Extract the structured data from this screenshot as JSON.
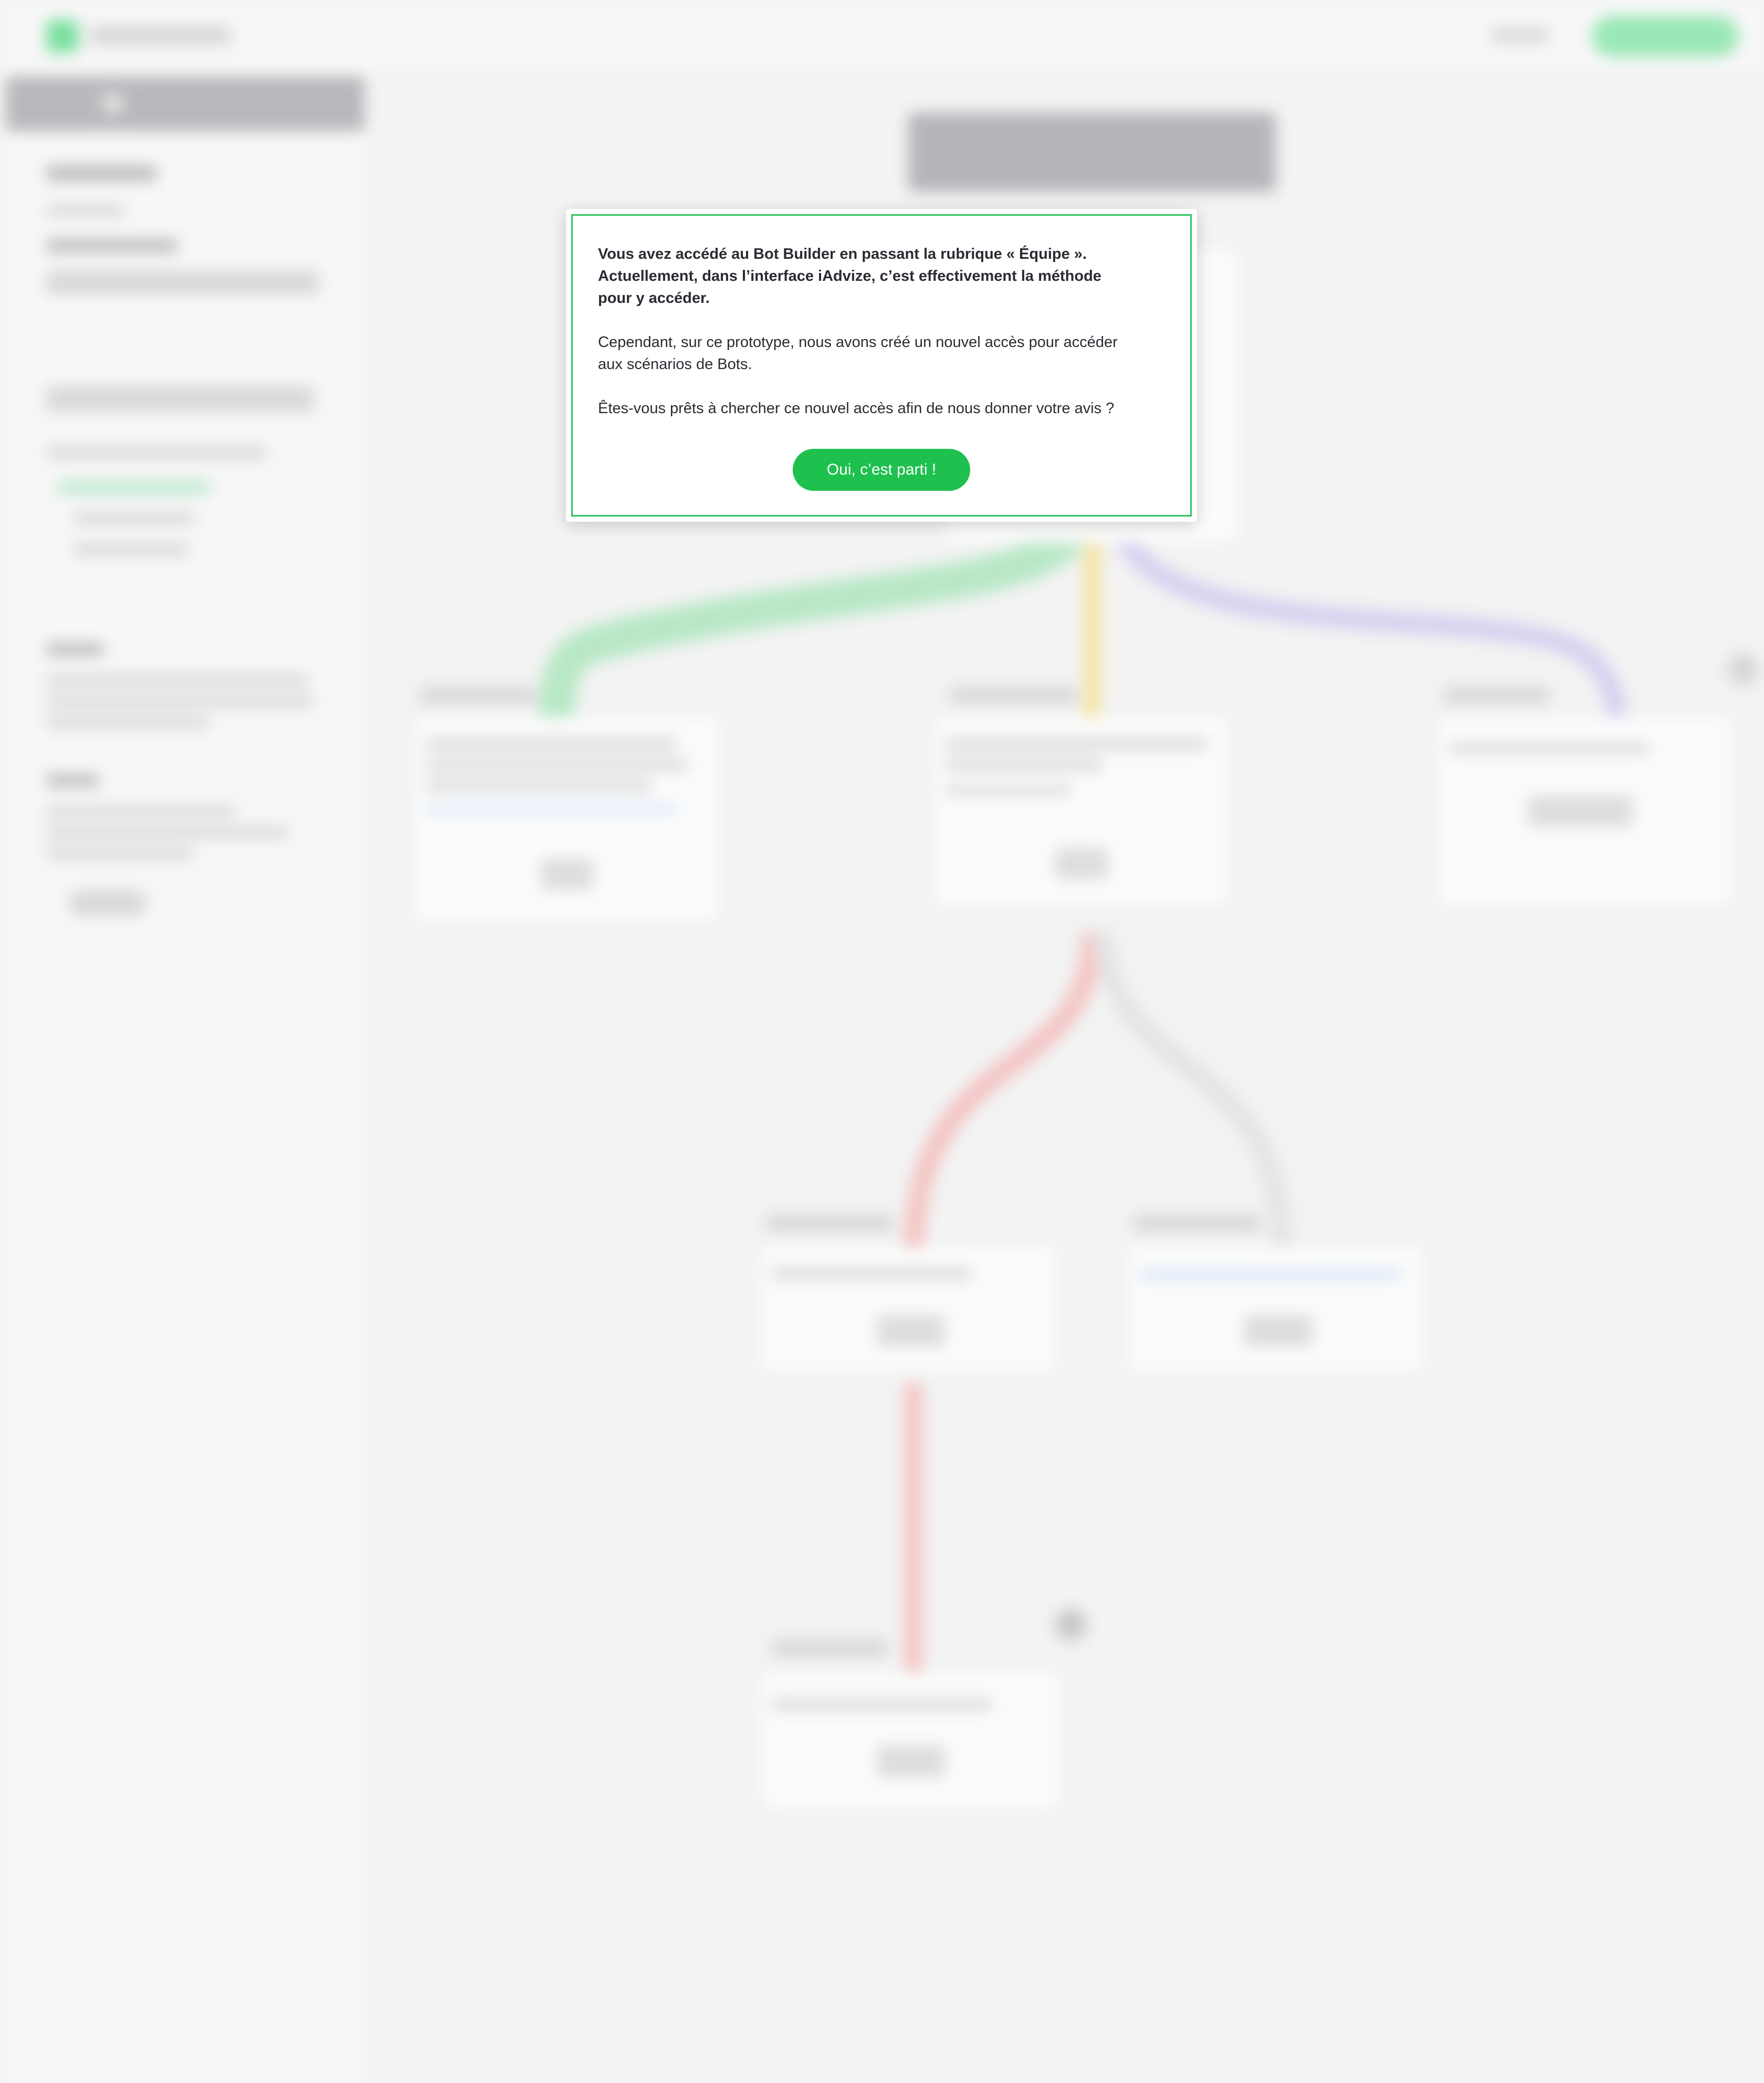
{
  "modal": {
    "intro_lines": [
      "Vous avez accédé au Bot Builder en passant la rubrique « Équipe ».",
      "Actuellement, dans l’interface iAdvize, c’est effectivement la méthode",
      "pour y accéder."
    ],
    "body_lines": [
      "Cependant, sur ce prototype, nous avons créé un nouvel accès pour accéder",
      "aux scénarios de Bots."
    ],
    "question": "Êtes-vous prêts à chercher ce nouvel accès afin de nous donner votre avis ?",
    "confirm_label": "Oui, c’est parti !"
  },
  "colors": {
    "modal_border": "#2dc55f",
    "primary_button": "#1fc14e",
    "wire_green": "#b8e8c6",
    "wire_yellow": "#f4e4a6",
    "wire_purple": "#d7d1f0",
    "wire_red": "#f4c4c4",
    "wire_gray": "#e4e4e4"
  }
}
